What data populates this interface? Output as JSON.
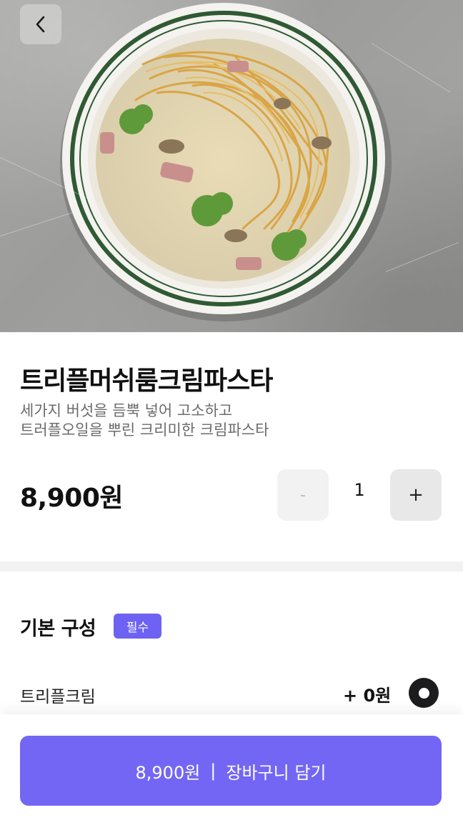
{
  "header": {
    "back_icon": "chevron-left-icon"
  },
  "product": {
    "name": "트리플머쉬룸크림파스타",
    "description_line1": "세가지 버섯을 듬뿍 넣어 고소하고",
    "description_line2": "트러플오일을 뿌린 크리미한 크림파스타",
    "price": "8,900원"
  },
  "quantity": {
    "minus_label": "-",
    "value": "1",
    "plus_label": "+"
  },
  "options": {
    "section_title": "기본 구성",
    "required_badge": "필수",
    "items": [
      {
        "name": "트리플크림",
        "price": "+ 0원",
        "selected": true
      }
    ]
  },
  "cart": {
    "price": "8,900원",
    "separator": "|",
    "label": "장바구니 담기"
  },
  "colors": {
    "accent": "#7366f4",
    "badge": "#6e62f2",
    "divider": "#f2f2f3"
  }
}
